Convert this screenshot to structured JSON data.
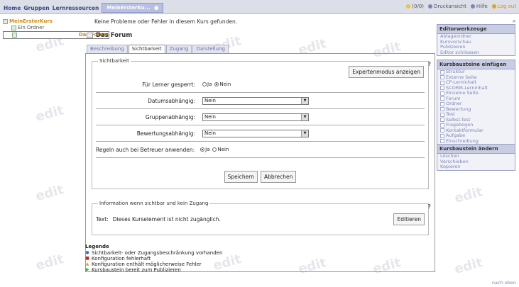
{
  "topbar": {
    "home": "Home",
    "groups": "Gruppen",
    "resources": "Lernressourcen",
    "active_tab": "MeinErsterKu...",
    "counter": "(0/0)",
    "print": "Druckansicht",
    "help": "Hilfe",
    "logout": "Log out"
  },
  "tree": {
    "root": "MeinErsterKurs",
    "items": [
      {
        "label": "Ein Ordner",
        "selected": false
      },
      {
        "label": "Das Forum",
        "selected": true
      }
    ]
  },
  "main": {
    "message": "Keine Probleme oder Fehler in diesem Kurs gefunden.",
    "title": "Das Forum",
    "tabs": [
      {
        "label": "Beschreibung",
        "active": false
      },
      {
        "label": "Sichtbarkeit",
        "active": true
      },
      {
        "label": "Zugang",
        "active": false
      },
      {
        "label": "Darstellung",
        "active": false
      }
    ],
    "visibility": {
      "legend": "Sichtbarkeit",
      "expert_button": "Expertenmodus anzeigen",
      "blocked_label": "Für Lerner gesperrt:",
      "yes": "Ja",
      "no": "Nein",
      "date_label": "Datumsabhängig:",
      "date_value": "Nein",
      "group_label": "Gruppenabhängig:",
      "group_value": "Nein",
      "assessment_label": "Bewertungsabhängig:",
      "assessment_value": "Nein",
      "coach_label": "Regeln auch bei Betreuer anwenden:",
      "save": "Speichern",
      "cancel": "Abbrechen"
    },
    "info": {
      "legend": "Information wenn sichtbar und kein Zugang",
      "text_label": "Text:",
      "text_value": "Dieses Kurselement ist nicht zugänglich.",
      "edit": "Editieren"
    }
  },
  "legend": {
    "heading": "Legende",
    "items": [
      {
        "label": "Sichtbarkeit- oder Zugangsbeschränkung vorhanden",
        "color": "#3a6ad8",
        "icon": "circle"
      },
      {
        "label": "Konfiguration fehlerhaft",
        "color": "#d02020",
        "icon": "square"
      },
      {
        "label": "Konfiguration enthält möglicherweise Fehler",
        "color": "#e0a020",
        "icon": "triangle"
      },
      {
        "label": "Kursbaustein bereit zum Publizieren",
        "color": "#30a030",
        "icon": "arrow"
      }
    ]
  },
  "sidebar": {
    "tools": {
      "heading": "Editorwerkzeuge",
      "items": [
        "Ablageordner",
        "Kursvorschau",
        "Publizieren",
        "Editor schliessen"
      ]
    },
    "insert": {
      "heading": "Kursbausteine einfügen",
      "items": [
        "Struktur",
        "Externe Seite",
        "CP-Lerninhalt",
        "SCORM-Lerninhalt",
        "Einzelne Seite",
        "Forum",
        "Ordner",
        "Bewertung",
        "Test",
        "Selbst-Test",
        "Fragebogen",
        "Kontaktformular",
        "Aufgabe",
        "Einschreibung"
      ]
    },
    "change": {
      "heading": "Kursbaustein ändern",
      "items": [
        "Löschen",
        "Verschieben",
        "Kopieren"
      ]
    }
  },
  "watermark": "edit",
  "top_link": "nach oben"
}
